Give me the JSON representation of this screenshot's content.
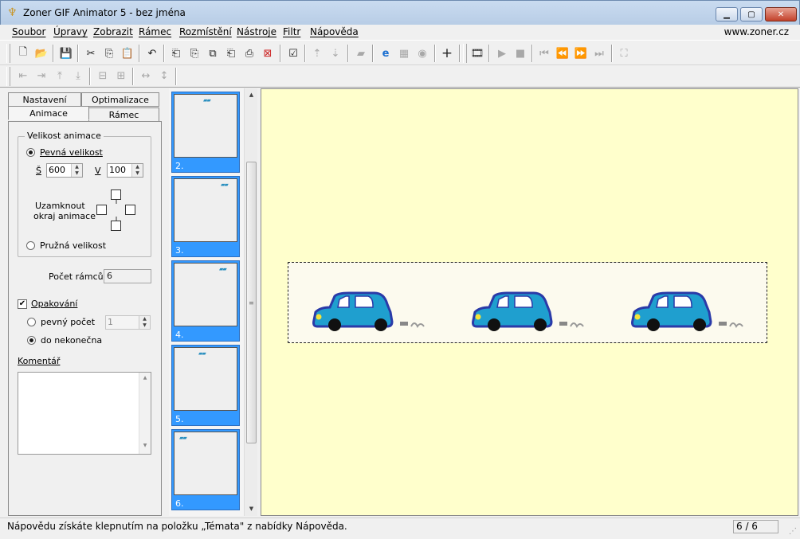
{
  "window": {
    "title": "Zoner GIF Animator 5 - bez jména"
  },
  "menu": {
    "items": [
      "Soubor",
      "Úpravy",
      "Zobrazit",
      "Rámec",
      "Rozmístění",
      "Nástroje",
      "Filtr",
      "Nápověda"
    ],
    "site": "www.zoner.cz"
  },
  "toolbar_icons": [
    "new-icon",
    "open-icon",
    "save-icon",
    "cut-icon",
    "copy-icon",
    "paste-icon",
    "undo-icon",
    "add-frame-icon",
    "insert-frame-icon",
    "duplicate-frame-icon",
    "frame-copy-icon",
    "frame-paste-icon",
    "delete-frame-icon",
    "frame-properties-icon",
    "move-frame-up-icon",
    "move-frame-down-icon",
    "effect-icon",
    "internet-explorer-icon",
    "web-preview-icon",
    "optimize-icon",
    "plus-icon",
    "animation-wizard-icon",
    "play-icon",
    "stop-icon",
    "first-frame-icon",
    "previous-frame-icon",
    "next-frame-icon",
    "last-frame-icon",
    "fullscreen-icon"
  ],
  "tabs": {
    "nastaveni": "Nastavení",
    "optimalizace": "Optimalizace",
    "animace": "Animace",
    "ramec": "Rámec"
  },
  "size_group": {
    "legend": "Velikost animace",
    "fixed_label": "Pevná velikost",
    "width_label": "Š",
    "width_value": "600",
    "height_label": "V",
    "height_value": "100",
    "lock_label_1": "Uzamknout",
    "lock_label_2": "okraj animace",
    "flexible_label": "Pružná velikost"
  },
  "frame_count": {
    "label": "Počet rámců:",
    "value": "6"
  },
  "repeat": {
    "label": "Opakování",
    "checked": true,
    "fixed_count_label": "pevný počet",
    "fixed_count_value": "1",
    "infinite_label": "do nekonečna"
  },
  "comment": {
    "label": "Komentář",
    "value": ""
  },
  "frames": [
    {
      "label": "2."
    },
    {
      "label": "3."
    },
    {
      "label": "4."
    },
    {
      "label": "5."
    },
    {
      "label": "6."
    }
  ],
  "status": {
    "message": "Nápovědu získáte klepnutím na položku „Témata\" z nabídky Nápověda.",
    "frame_indicator": "6 / 6"
  },
  "colors": {
    "canvas_bg": "#ffffcc",
    "selection": "#3399ff",
    "car": "#1f9fcf"
  }
}
